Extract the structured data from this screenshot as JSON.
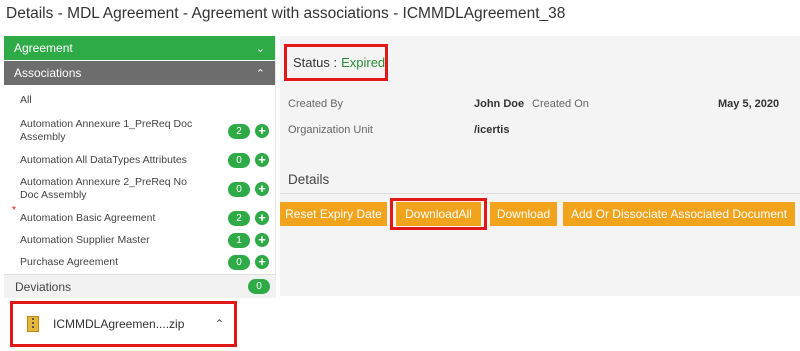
{
  "header": {
    "title": "Details - MDL Agreement - Agreement with associations - ICMMDLAgreement_38"
  },
  "sidebar": {
    "agreement_label": "Agreement",
    "associations_label": "Associations",
    "all_label": "All",
    "items": [
      {
        "name": "Automation Annexure 1_PreReq Doc Assembly",
        "count": "2",
        "required": false
      },
      {
        "name": "Automation All DataTypes Attributes",
        "count": "0",
        "required": false
      },
      {
        "name": "Automation Annexure 2_PreReq No Doc Assembly",
        "count": "0",
        "required": false
      },
      {
        "name": "Automation Basic Agreement",
        "count": "2",
        "required": true,
        "required_mark": "*"
      },
      {
        "name": "Automation Supplier Master",
        "count": "1",
        "required": false
      },
      {
        "name": "Purchase Agreement",
        "count": "0",
        "required": false
      }
    ],
    "deviations": {
      "label": "Deviations",
      "count": "0"
    }
  },
  "download": {
    "filename": "ICMMDLAgreemen....zip"
  },
  "main": {
    "status_label": "Status :",
    "status_value": "Expired",
    "created_by_label": "Created By",
    "created_by_value": "John Doe",
    "created_on_label": "Created On",
    "created_on_value": "May 5, 2020",
    "org_unit_label": "Organization Unit",
    "org_unit_value": "/icertis",
    "details_title": "Details",
    "buttons": {
      "reset_expiry": "Reset Expiry Date",
      "download_all": "DownloadAll",
      "download": "Download",
      "add_dissociate": "Add Or Dissociate Associated Document"
    }
  },
  "colors": {
    "accent_green": "#2eaa46",
    "button_orange": "#f0a31b",
    "highlight_red": "#e01818",
    "status_green": "#2e8b3a"
  }
}
